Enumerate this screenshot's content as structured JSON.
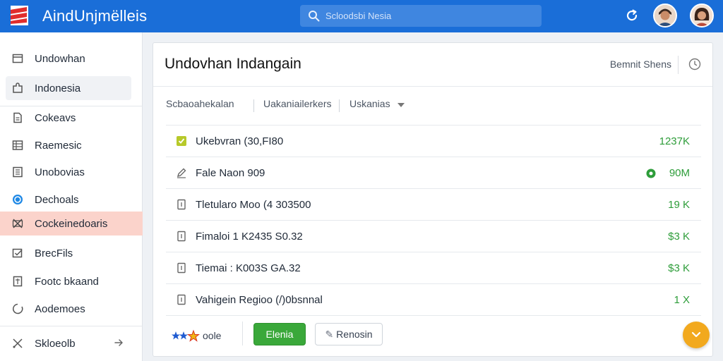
{
  "app": {
    "brand": "AindUnjmëlleis",
    "search_placeholder": "Scloodsbi Nesia"
  },
  "sidebar": {
    "items": [
      {
        "label": "Undowhan",
        "icon": "window-icon"
      },
      {
        "label": "Indonesia",
        "icon": "puzzle-icon"
      },
      {
        "label": "Cokeavs",
        "icon": "document-icon"
      },
      {
        "label": "Raemesic",
        "icon": "table-icon"
      },
      {
        "label": "Unobovias",
        "icon": "list-icon"
      },
      {
        "label": "Dechoals",
        "icon": "globe-icon"
      },
      {
        "label": "Cockeinedoaris",
        "icon": "scissors-icon"
      },
      {
        "label": "BrecFils",
        "icon": "checkbox-icon"
      },
      {
        "label": "Footc bkaand",
        "icon": "file-icon"
      },
      {
        "label": "Aodemoes",
        "icon": "circle-icon"
      },
      {
        "label": "Skloeolb",
        "icon": "share-icon"
      }
    ]
  },
  "card": {
    "title": "Undovhan  Indangain",
    "header_link": "Bemnit Shens",
    "filters": [
      "Scbaoahekalan",
      "Uakaniailerkers",
      "Uskanias"
    ],
    "rows": [
      {
        "label": "Ukebvran (30,FI80",
        "value": "1237K"
      },
      {
        "label": "Fale  Naon  909",
        "value": "90M"
      },
      {
        "label": "Tletularo Moo (4  303500",
        "value": "19 K"
      },
      {
        "label": "Fimaloi  1 K2435  S0.32",
        "value": "$3 K"
      },
      {
        "label": "Tiemai  :  K003S  GA.32",
        "value": "$3 K"
      },
      {
        "label": "Vahigein  Regioo (/)0bsnnal",
        "value": "1 X"
      }
    ],
    "footer": {
      "rating_label": "oole",
      "primary_button": "Elenia",
      "secondary_button": "Renosin"
    }
  },
  "colors": {
    "topbar": "#1a6ed8",
    "active_item": "#fbd3cb",
    "value_green": "#2e9d3a",
    "primary_button": "#3aa83a",
    "fab": "#f2a91e"
  }
}
